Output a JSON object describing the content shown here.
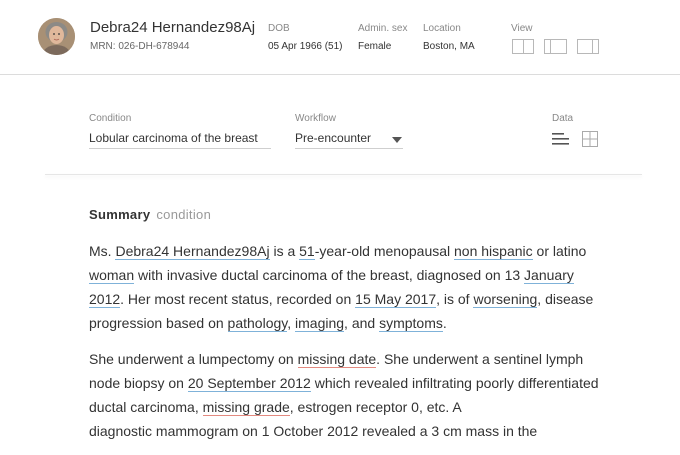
{
  "patient": {
    "name": "Debra24 Hernandez98Aj",
    "mrn": "MRN: 026-DH-678944",
    "dob_label": "DOB",
    "dob_value": "05 Apr 1966 (51)",
    "sex_label": "Admin. sex",
    "sex_value": "Female",
    "location_label": "Location",
    "location_value": "Boston, MA"
  },
  "view": {
    "label": "View",
    "options": [
      "left-pane-layout",
      "wide-pane-layout",
      "right-pane-layout"
    ]
  },
  "selectors": {
    "condition_label": "Condition",
    "condition_value": "Lobular carcinoma of the breast",
    "workflow_label": "Workflow",
    "workflow_value": "Pre-encounter",
    "data_label": "Data"
  },
  "summary": {
    "title": "Summary",
    "subtitle": "condition",
    "p1": {
      "t1": "Ms. ",
      "name": "Debra24 Hernandez98Aj",
      "t2": " is a ",
      "age": "51",
      "t3": "-year-old menopausal ",
      "ethnicity": "non hispanic",
      "t4": " or latino ",
      "gender": "woman",
      "t5": " with invasive ductal carcinoma of the breast, diagnosed on 13 ",
      "diag_date": "January 2012",
      "t6": ".  Her most recent status, recorded on ",
      "status_date": "15 May 2017",
      "t7": ", is of ",
      "status": "worsening",
      "t8": ", disease progression based on ",
      "basis1": "pathology",
      "t9": ", ",
      "basis2": "imaging",
      "t10": ", and ",
      "basis3": "symptoms",
      "t11": "."
    },
    "p2": {
      "t1": "She underwent a lumpectomy on ",
      "missing_date": "missing date",
      "t2": ". She underwent a sentinel lymph node biopsy on ",
      "biopsy_date": "20 September 2012",
      "t3": " which revealed infiltrating poorly differentiated ductal carcinoma, ",
      "missing_grade": "missing grade",
      "t4": ", estrogen receptor 0, etc. A",
      "t5": "diagnostic mammogram on 1 October 2012 revealed a 3 cm mass in the"
    }
  },
  "colors": {
    "link_underline": "#7fb2d9",
    "missing_underline": "#e48a80"
  }
}
